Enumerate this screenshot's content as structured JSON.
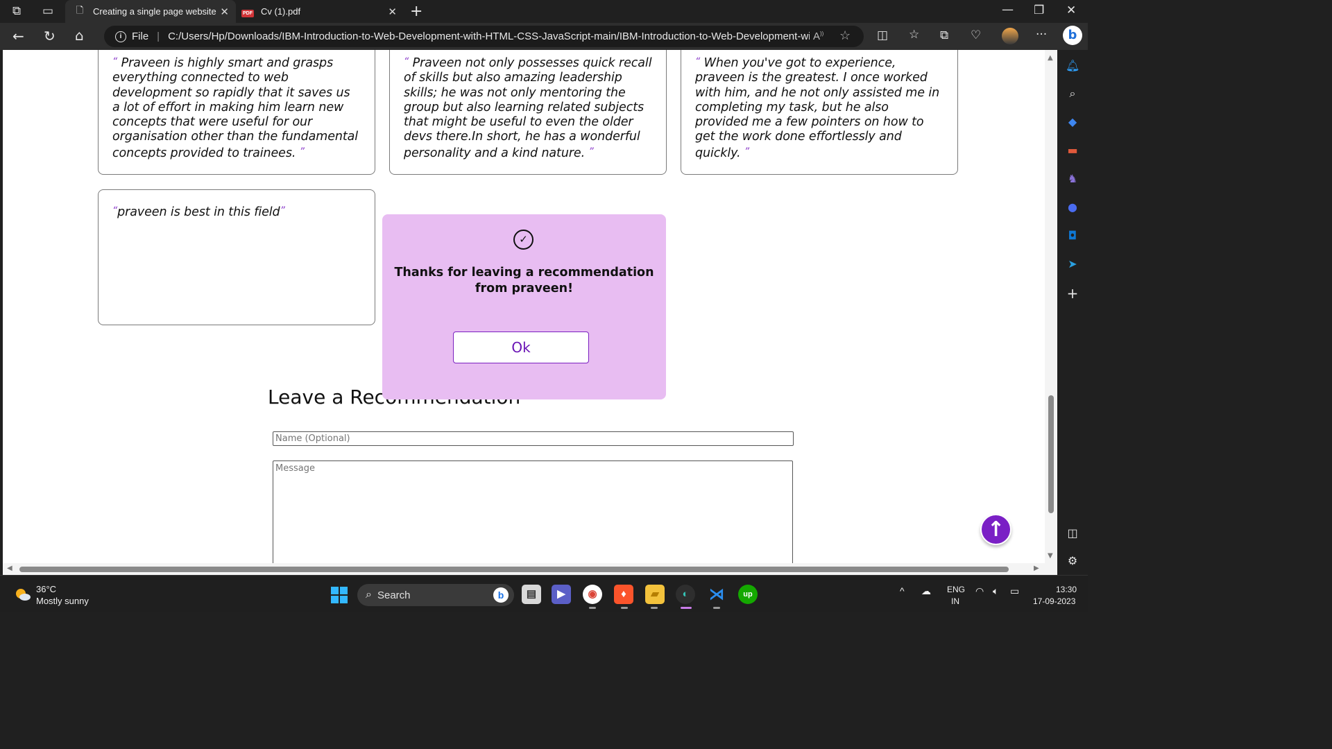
{
  "browser": {
    "tabs": [
      {
        "title": "Creating a single page website",
        "active": true
      },
      {
        "title": "Cv (1).pdf",
        "active": false,
        "badge": "PDF"
      }
    ],
    "address": {
      "scheme_label": "File",
      "url": "C:/Users/Hp/Downloads/IBM-Introduction-to-Web-Development-with-HTML-CSS-JavaScript-main/IBM-Introduction-to-Web-Development-with..."
    },
    "icons": {
      "workspaces": "workspaces-icon",
      "tab_actions": "tab-actions-icon",
      "back": "back-arrow-icon",
      "refresh": "refresh-icon",
      "home": "home-icon",
      "read_aloud": "read-aloud-icon",
      "favorite": "star-icon",
      "split_screen": "split-screen-icon",
      "favorites": "favorites-icon",
      "collections": "collections-icon",
      "health": "browser-essentials-icon",
      "profile": "profile-avatar",
      "more": "more-icon",
      "copilot": "bing-copilot-icon"
    }
  },
  "page": {
    "recommendations": [
      {
        "text": "Praveen is highly smart and grasps everything connected to web development so rapidly that it saves us a lot of effort in making him learn new concepts that were useful for our organisation other than the fundamental concepts provided to trainees."
      },
      {
        "text": "Praveen not only possesses quick recall of skills but also amazing leadership skills; he was not only mentoring the group but also learning related subjects that might be useful to even the older devs there.In short, he has a wonderful personality and a kind nature."
      },
      {
        "text": "When you've got to experience, praveen is the greatest. I once worked with him, and he not only assisted me in completing my task, but he also provided me a few pointers on how to get the work done effortlessly and quickly."
      },
      {
        "text": "praveen is best in this field"
      }
    ],
    "quote_open": "“",
    "quote_close": "”",
    "modal": {
      "message": "Thanks for leaving a recommendation from praveen!",
      "ok_label": "Ok",
      "icon": "check-circle-icon",
      "background": "#e8bdf2"
    },
    "form": {
      "title": "Leave a Recommendation",
      "name_placeholder": "Name (Optional)",
      "message_placeholder": "Message"
    },
    "scroll_top_icon": "arrow-up-icon",
    "accent_color": "#7a1fc5"
  },
  "taskbar": {
    "weather": {
      "temp": "36°C",
      "desc": "Mostly sunny"
    },
    "search_label": "Search",
    "apps": [
      "file-icon",
      "teams-icon",
      "chrome-icon",
      "brave-icon",
      "file-explorer-icon",
      "edge-icon",
      "vscode-icon",
      "upwork-icon"
    ],
    "tray": {
      "lang_line1": "ENG",
      "lang_line2": "IN",
      "time": "13:30",
      "date": "17-09-2023"
    }
  }
}
